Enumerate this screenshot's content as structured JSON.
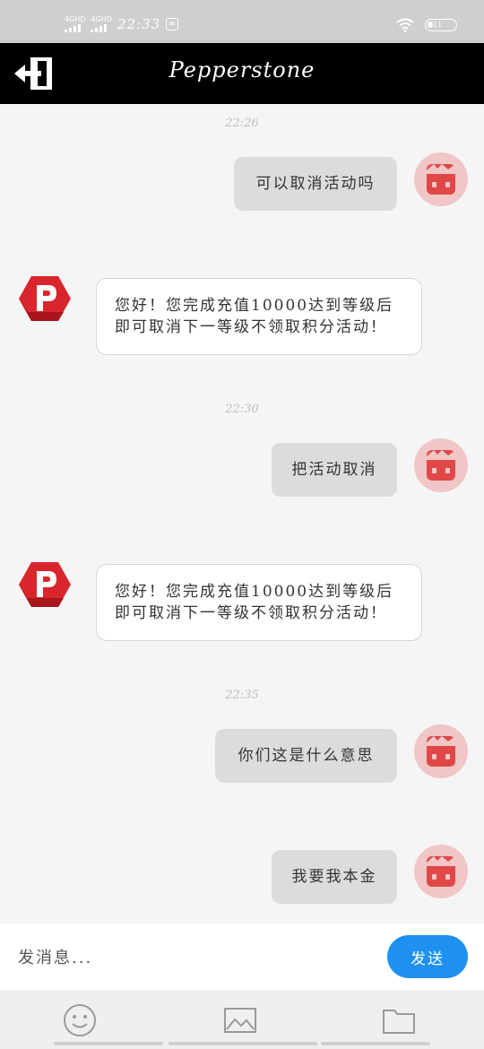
{
  "status_bar": {
    "network1": "4GHD",
    "network2": "4GHD",
    "time": "22:33",
    "battery": "11"
  },
  "header": {
    "title": "Pepperstone",
    "exit_icon": "exit-icon"
  },
  "messages": [
    {
      "type": "timestamp",
      "text": "22:26"
    },
    {
      "type": "me",
      "text": "可以取消活动吗"
    },
    {
      "type": "them",
      "text": "您好！您完成充值10000达到等级后即可取消下一等级不领取积分活动！"
    },
    {
      "type": "timestamp",
      "text": "22:30"
    },
    {
      "type": "me",
      "text": "把活动取消"
    },
    {
      "type": "them",
      "text": "您好！您完成充值10000达到等级后即可取消下一等级不领取积分活动！"
    },
    {
      "type": "timestamp",
      "text": "22:35"
    },
    {
      "type": "me",
      "text": "你们这是什么意思"
    },
    {
      "type": "me",
      "text": "我要我本金"
    }
  ],
  "input": {
    "placeholder": "发消息...",
    "send_label": "发送"
  },
  "tools": [
    "emoji-icon",
    "image-icon",
    "folder-icon"
  ],
  "colors": {
    "header_bg": "#000000",
    "send_button": "#1e90f0",
    "my_bubble": "#dcdcdc",
    "avatar_red": "#e04848",
    "brand_red": "#d9262c"
  }
}
